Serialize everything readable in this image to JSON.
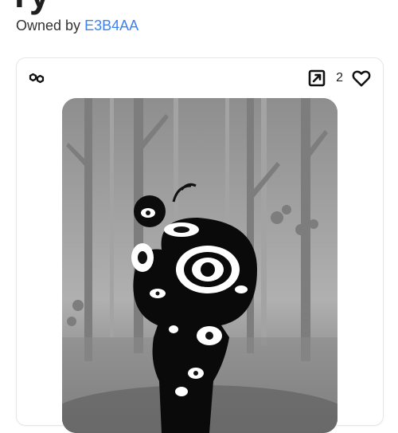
{
  "header": {
    "title_fragment": "ry",
    "owned_prefix": "Owned by",
    "owner": "E3B4AA"
  },
  "card": {
    "chain_icon": "polygon-chain-icon",
    "external_icon": "external-link-icon",
    "likes": "2",
    "heart_icon": "heart-outline-icon"
  },
  "colors": {
    "link": "#3b82f6",
    "text": "#222222",
    "border": "#e6e6e6"
  }
}
